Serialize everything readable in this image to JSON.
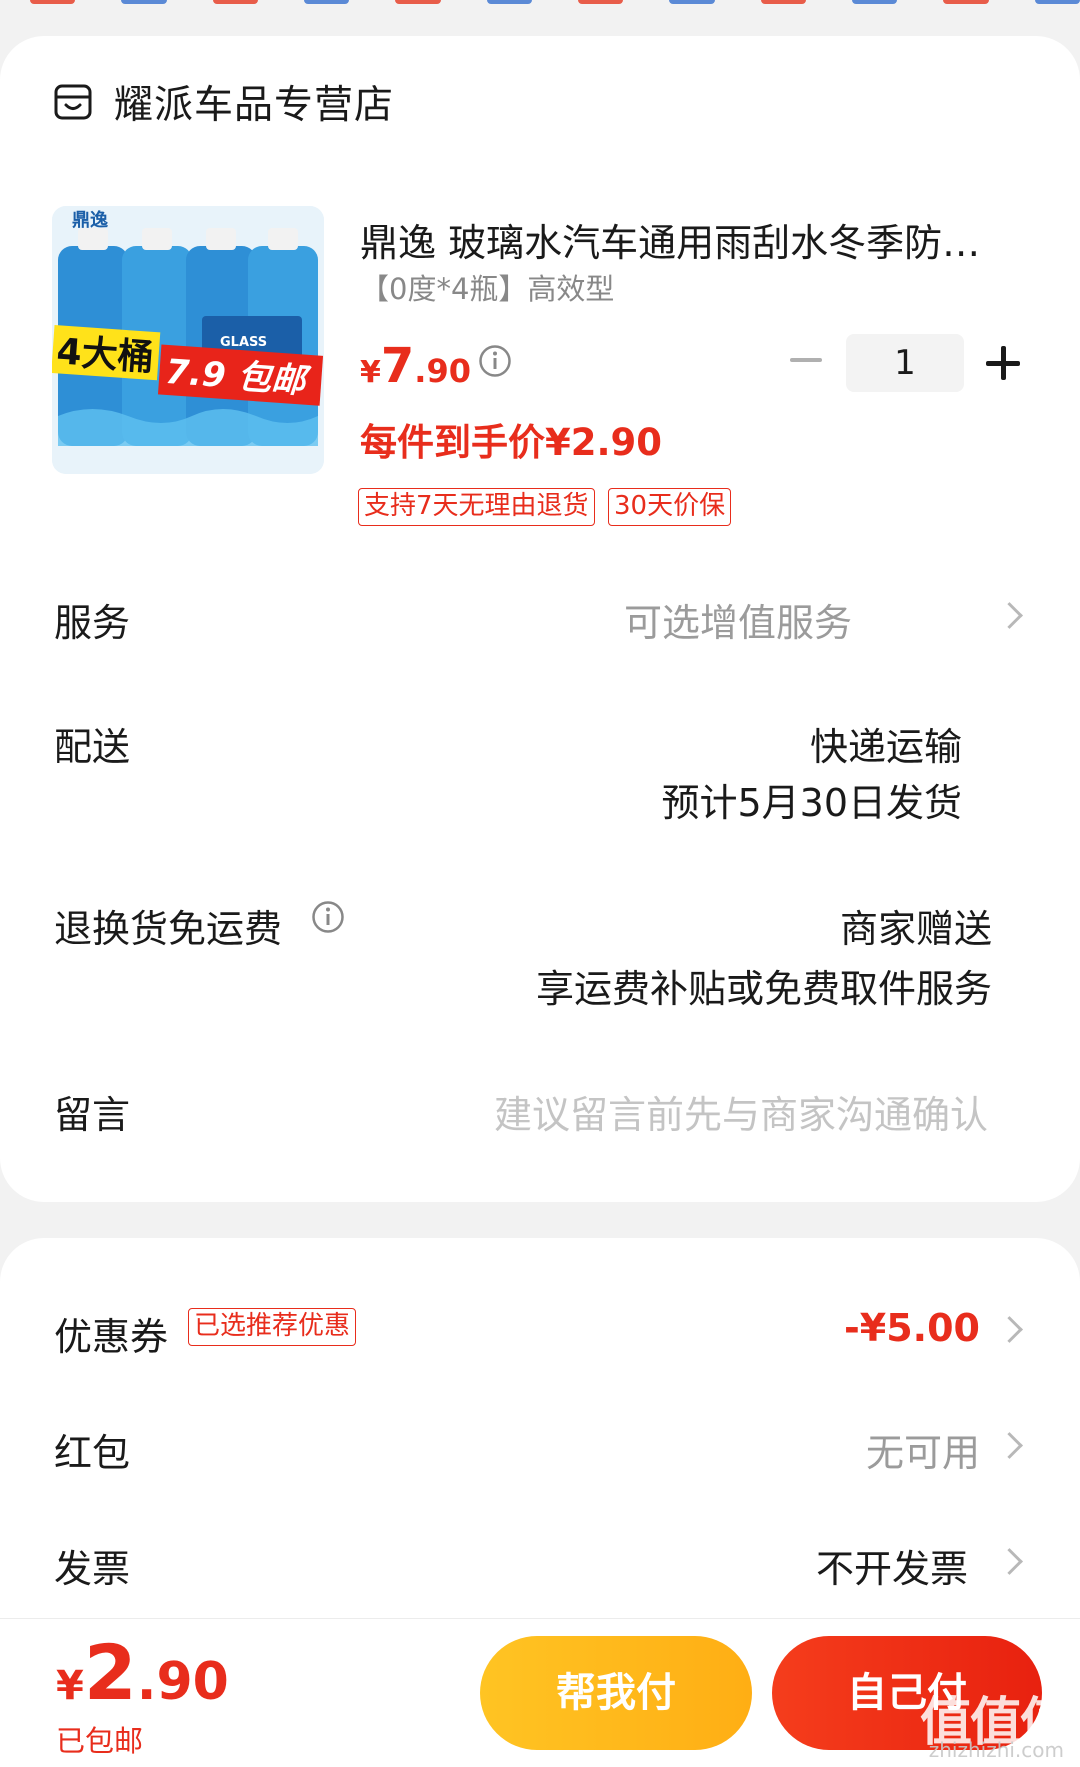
{
  "store": {
    "name": "耀派车品专营店",
    "icon": "store-icon"
  },
  "product": {
    "title": "鼎逸 玻璃水汽车通用雨刮水冬季防…",
    "spec": "【0度*4瓶】高效型",
    "price_currency": "¥",
    "price_int": "7",
    "price_dec": ".90",
    "final_price": "每件到手价¥2.90",
    "tags": [
      "支持7天无理由退货",
      "30天价保"
    ],
    "quantity": "1",
    "image": {
      "brand": "鼎逸",
      "banner_left": "4大桶",
      "banner_right": "7.9 包邮",
      "bottle_label": "GLASS"
    }
  },
  "service": {
    "label": "服务",
    "value": "可选增值服务"
  },
  "delivery": {
    "label": "配送",
    "method": "快递运输",
    "eta": "预计5月30日发货"
  },
  "return_shipping": {
    "label": "退换货免运费",
    "value": "商家赠送",
    "detail": "享运费补贴或免费取件服务"
  },
  "message": {
    "label": "留言",
    "placeholder": "建议留言前先与商家沟通确认"
  },
  "coupon": {
    "label": "优惠券",
    "tag": "已选推荐优惠",
    "value": "-¥5.00"
  },
  "red_packet": {
    "label": "红包",
    "value": "无可用"
  },
  "invoice": {
    "label": "发票",
    "value": "不开发票"
  },
  "footer": {
    "total_currency": "¥",
    "total_int": "2",
    "total_dec": ".90",
    "shipping": "已包邮",
    "help_pay": "帮我付",
    "self_pay": "自己付",
    "watermark": "值值值",
    "watermark_url": "zhizhizhi.com"
  },
  "colors": {
    "accent": "#e82d1c",
    "yellow": "#ffb91d"
  }
}
